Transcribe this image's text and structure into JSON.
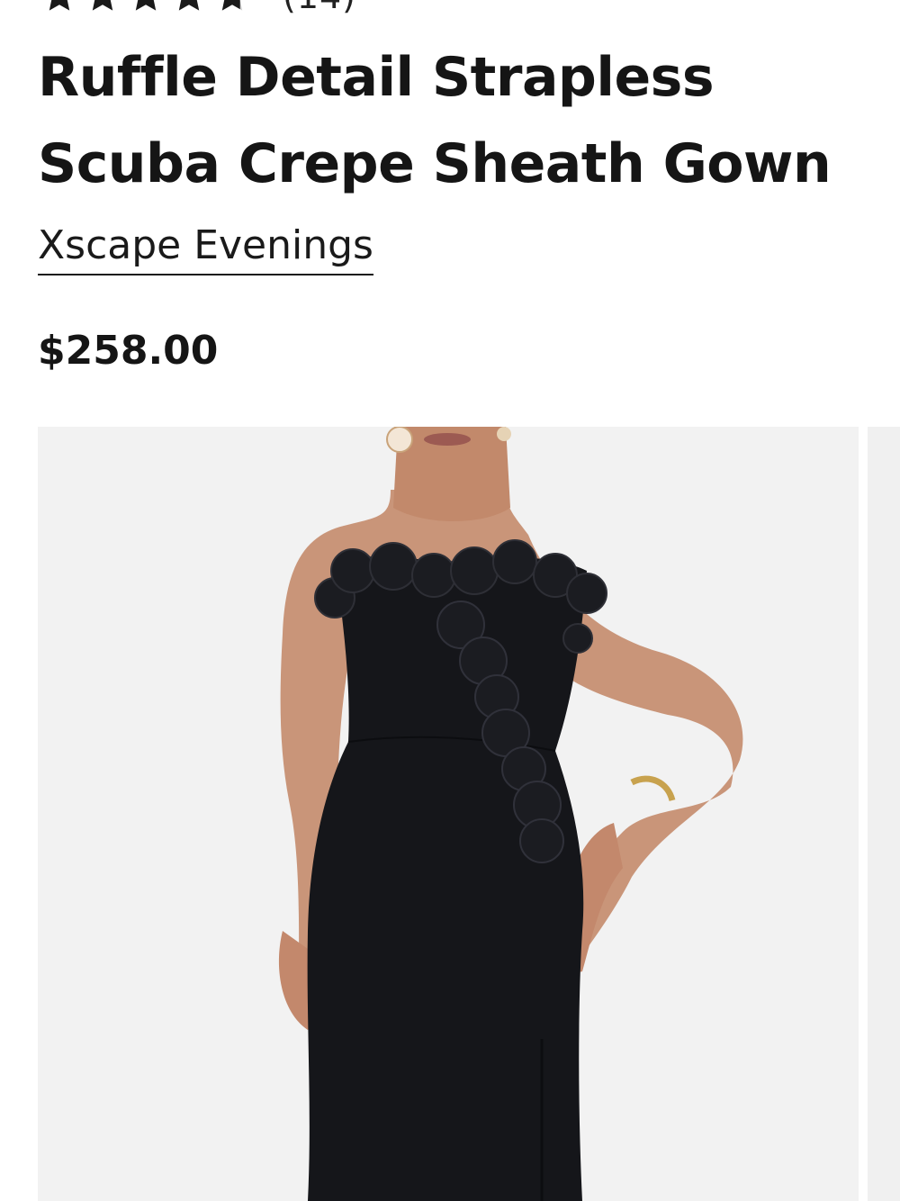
{
  "product": {
    "rating": {
      "stars": 4.7,
      "max_stars": 5,
      "review_count_text": "(14)"
    },
    "title": "Ruffle Detail Strapless Scuba Crepe Sheath Gown",
    "brand": "Xscape Evenings",
    "price": "$258.00"
  },
  "gallery": {
    "current_image": "model-black-strapless-ruffle-gown",
    "next_image_peek": true
  },
  "colors": {
    "star": "#1a1a1a",
    "gown": "#15161a",
    "skin": "#c99579",
    "background": "#f2f2f2"
  },
  "icons": [
    "star-icon"
  ]
}
